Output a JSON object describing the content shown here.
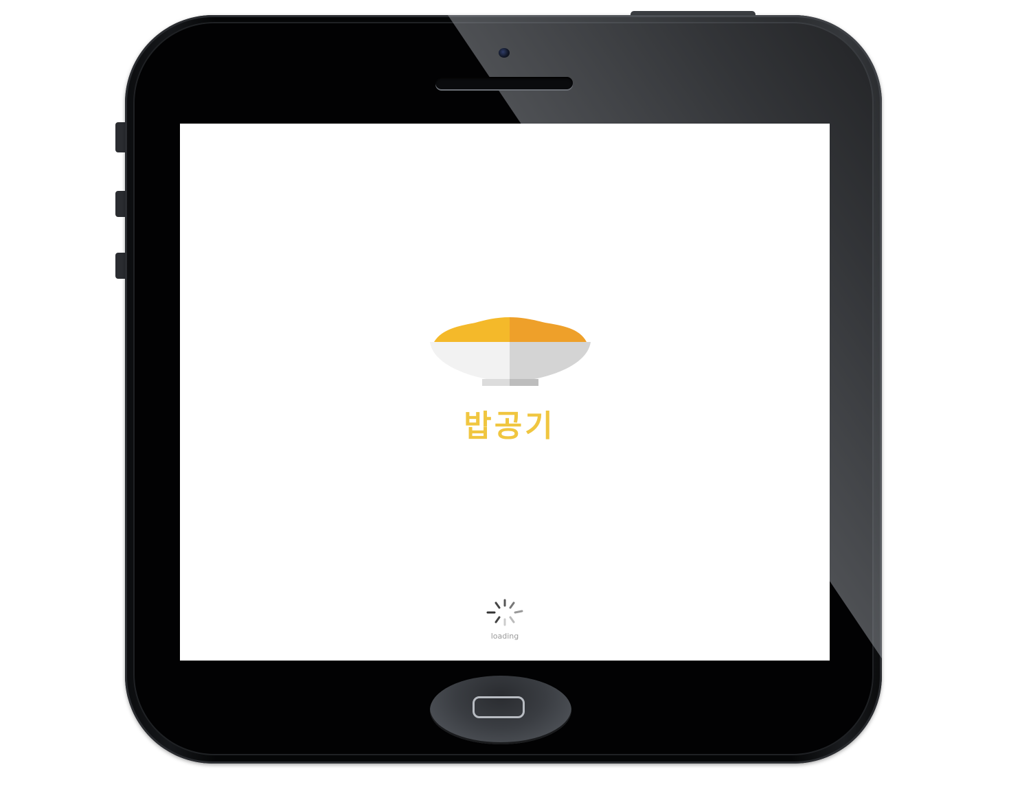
{
  "app": {
    "name": "밥공기",
    "loading_text": "loading"
  },
  "colors": {
    "brand_yellow": "#f0c640",
    "rice_light": "#f4b92a",
    "rice_dark": "#eea02a",
    "bowl_light": "#f2f2f2",
    "bowl_dark": "#d4d4d4"
  },
  "icons": {
    "logo": "rice-bowl-icon",
    "spinner": "loading-spinner-icon",
    "home": "home-button-icon"
  }
}
